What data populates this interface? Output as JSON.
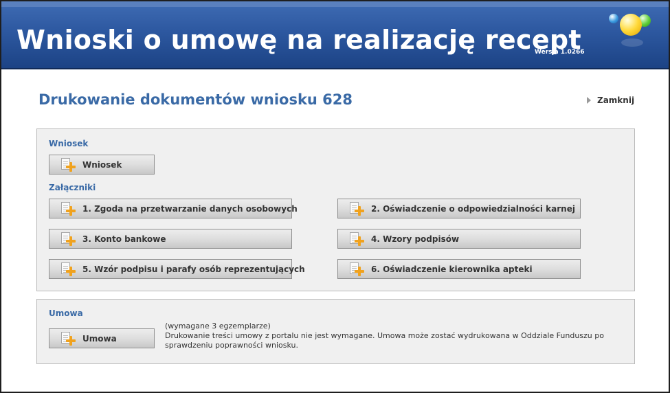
{
  "header": {
    "app_title": "Wnioski o umowę na realizację recept",
    "version": "Wersja 1.0266",
    "logo_icon": "colored-balls-logo"
  },
  "page": {
    "title": "Drukowanie dokumentów wniosku  628",
    "close_label": "Zamknij"
  },
  "wniosek_section": {
    "label": "Wniosek",
    "button_label": "Wniosek"
  },
  "zalaczniki_section": {
    "label": "Załączniki",
    "items": [
      {
        "label": "1. Zgoda na przetwarzanie danych osobowych"
      },
      {
        "label": "2. Oświadczenie o odpowiedzialności karnej"
      },
      {
        "label": "3. Konto bankowe"
      },
      {
        "label": "4. Wzory podpisów"
      },
      {
        "label": "5. Wzór podpisu i parafy osób reprezentujących"
      },
      {
        "label": "6. Oświadczenie kierownika apteki"
      }
    ]
  },
  "umowa_section": {
    "label": "Umowa",
    "button_label": "Umowa",
    "note_required": "(wymagane 3 egzemplarze)",
    "note_text": "Drukowanie treści umowy z portalu nie jest wymagane. Umowa może zostać wydrukowana w Oddziale Funduszu po sprawdzeniu poprawności wniosku."
  },
  "icons": {
    "document_button_icon": "document-add-icon",
    "close_icon": "arrow-right-icon"
  },
  "colors": {
    "banner": "#2d58a0",
    "title_blue": "#3a6aa6",
    "plus_orange": "#f0a21e"
  }
}
